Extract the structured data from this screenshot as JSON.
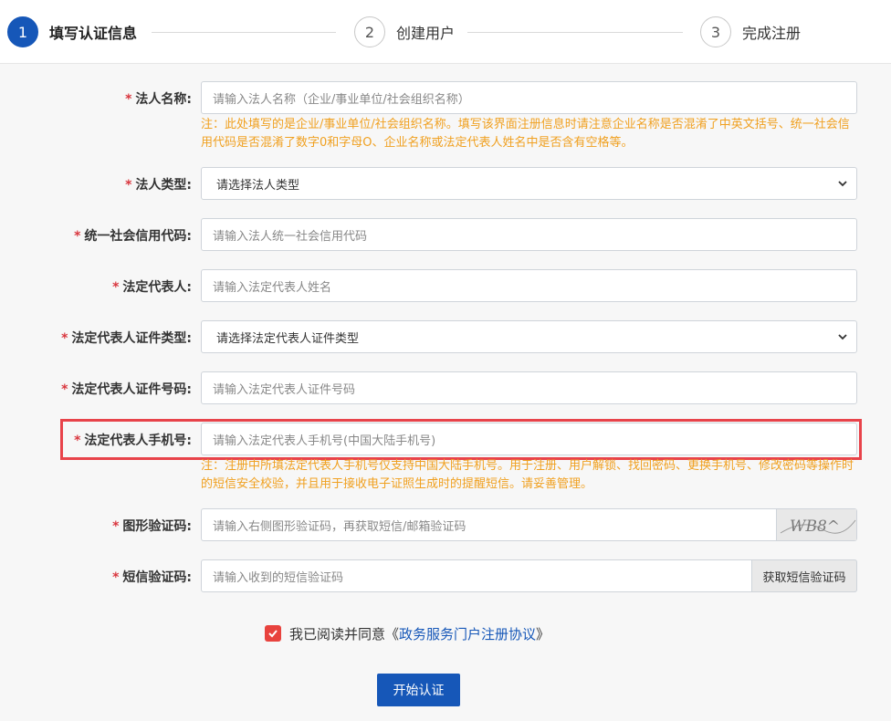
{
  "steps": [
    {
      "number": "1",
      "label": "填写认证信息",
      "active": true
    },
    {
      "number": "2",
      "label": "创建用户",
      "active": false
    },
    {
      "number": "3",
      "label": "完成注册",
      "active": false
    }
  ],
  "required_mark": "*",
  "fields": {
    "legal_name": {
      "label": "法人名称:",
      "placeholder": "请输入法人名称（企业/事业单位/社会组织名称）",
      "note": "注：此处填写的是企业/事业单位/社会组织名称。填写该界面注册信息时请注意企业名称是否混淆了中英文括号、统一社会信用代码是否混淆了数字0和字母O、企业名称或法定代表人姓名中是否含有空格等。"
    },
    "legal_type": {
      "label": "法人类型:",
      "selected": "请选择法人类型"
    },
    "credit_code": {
      "label": "统一社会信用代码:",
      "placeholder": "请输入法人统一社会信用代码"
    },
    "rep_name": {
      "label": "法定代表人:",
      "placeholder": "请输入法定代表人姓名"
    },
    "rep_id_type": {
      "label": "法定代表人证件类型:",
      "selected": "请选择法定代表人证件类型"
    },
    "rep_id_number": {
      "label": "法定代表人证件号码:",
      "placeholder": "请输入法定代表人证件号码"
    },
    "rep_phone": {
      "label": "法定代表人手机号:",
      "placeholder": "请输入法定代表人手机号(中国大陆手机号)",
      "note": "注：注册中所填法定代表人手机号仅支持中国大陆手机号。用于注册、用户解锁、找回密码、更换手机号、修改密码等操作时的短信安全校验，并且用于接收电子证照生成时的提醒短信。请妥善管理。"
    },
    "captcha": {
      "label": "图形验证码:",
      "placeholder": "请输入右侧图形验证码，再获取短信/邮箱验证码",
      "image_text": "WB8^"
    },
    "sms_code": {
      "label": "短信验证码:",
      "placeholder": "请输入收到的短信验证码",
      "button": "获取短信验证码"
    }
  },
  "agreement": {
    "prefix": "我已阅读并同意《",
    "link": " 政务服务门户注册协议 ",
    "suffix": "》",
    "checked": true
  },
  "submit_label": "开始认证",
  "colors": {
    "primary": "#1657b8",
    "required": "#d9363e",
    "note": "#f0a020",
    "highlight": "#e8434a"
  }
}
